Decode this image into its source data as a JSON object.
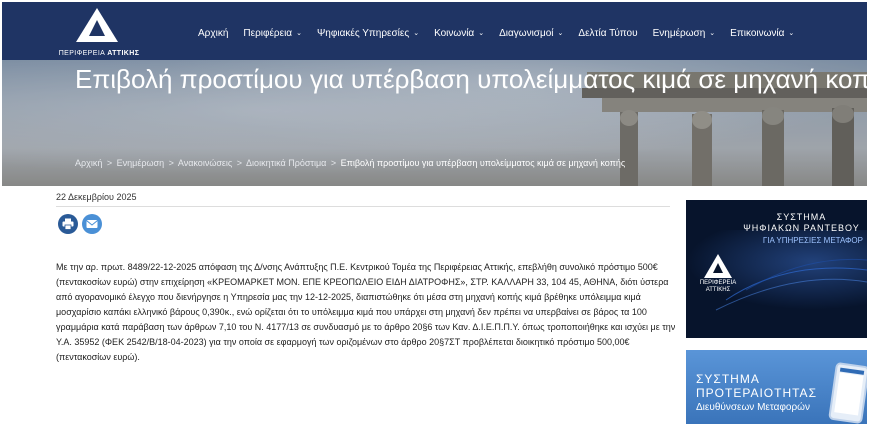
{
  "header": {
    "logo_text_regular": "ΠΕΡΙΦΕΡΕΙΑ",
    "logo_text_bold": "ΑΤΤΙΚΗΣ",
    "nav": [
      {
        "label": "Αρχική",
        "dropdown": false
      },
      {
        "label": "Περιφέρεια",
        "dropdown": true
      },
      {
        "label": "Ψηφιακές Υπηρεσίες",
        "dropdown": true
      },
      {
        "label": "Κοινωνία",
        "dropdown": true
      },
      {
        "label": "Διαγωνισμοί",
        "dropdown": true
      },
      {
        "label": "Δελτία Τύπου",
        "dropdown": false
      },
      {
        "label": "Ενημέρωση",
        "dropdown": true
      },
      {
        "label": "Επικοινωνία",
        "dropdown": true
      }
    ]
  },
  "hero": {
    "title": "Επιβολή προστίμου για υπέρβαση υπολείμματος κιμά σε μηχανή κοπ",
    "breadcrumb": {
      "items": [
        "Αρχική",
        "Ενημέρωση",
        "Ανακοινώσεις",
        "Διοικητικά Πρόστιμα"
      ],
      "separator": ">",
      "current": "Επιβολή προστίμου για υπέρβαση υπολείμματος κιμά σε μηχανή κοπής"
    }
  },
  "article": {
    "date": "22 Δεκεμβρίου 2025",
    "body": "Με την αρ. πρωτ. 8489/22-12-2025 απόφαση της Δ/νσης Ανάπτυξης Π.Ε. Κεντρικού Τομέα της Περιφέρειας Αττικής, επεβλήθη συνολικό πρόστιμο 500€ (πεντακοσίων ευρώ) στην επιχείρηση «ΚΡΕΟΜΑΡΚΕΤ ΜΟΝ. ΕΠΕ ΚΡΕΟΠΩΛΕΙΟ ΕΙΔΗ ΔΙΑΤΡΟΦΗΣ», ΣΤΡ. ΚΑΛΛΑΡΗ 33, 104 45, ΑΘΗΝΑ, διότι ύστερα από αγορανομικό έλεγχο που διενήργησε η Υπηρεσία μας την 12-12-2025, διαπιστώθηκε ότι μέσα στη μηχανή κοπής κιμά βρέθηκε υπόλειμμα κιμά μοσχαρίσιο καπάκι ελληνικό βάρους 0,390κ., ενώ ορίζεται ότι το υπόλειμμα κιμά που υπάρχει στη μηχανή δεν πρέπει να υπερβαίνει σε βάρος τα 100 γραμμάρια κατά παράβαση των άρθρων 7,10 του Ν. 4177/13 σε συνδυασμό με το άρθρο 20§6 των Καν. Δ.Ι.Ε.Π.Π.Υ. όπως τροποποιήθηκε και ισχύει με την Υ.Α. 35952 (ΦΕΚ 2542/Β/18-04-2023) για την οποία σε εφαρμογή των οριζομένων στο άρθρο 20§7ΣΤ προβλέπεται διοικητικό πρόστιμο 500,00€ (πεντακοσίων ευρώ)."
  },
  "sidebar": {
    "ad1": {
      "title_line1": "ΣΥΣΤΗΜΑ",
      "title_line2": "ΨΗΦΙΑΚΩΝ ΡΑΝΤΕΒΟΥ",
      "subtitle": "ΓΙΑ ΥΠΗΡΕΣΙΕΣ ΜΕΤΑΦΟΡ",
      "logo_line1": "ΠΕΡΙΦΕΡΕΙΑ",
      "logo_line2": "ΑΤΤΙΚΗΣ"
    },
    "ad2": {
      "title_line1": "ΣΥΣΤΗΜΑ",
      "title_line2": "ΠΡΟΤΕΡΑΙΟΤΗΤΑΣ",
      "subtitle": "Διευθύνσεων Μεταφορών"
    }
  },
  "colors": {
    "header_bg": "#1f3464",
    "print_button": "#2a5a97",
    "mail_button": "#4a90d6",
    "ad1_bg": "#07142c",
    "ad2_bg": "#3f7cc4"
  }
}
